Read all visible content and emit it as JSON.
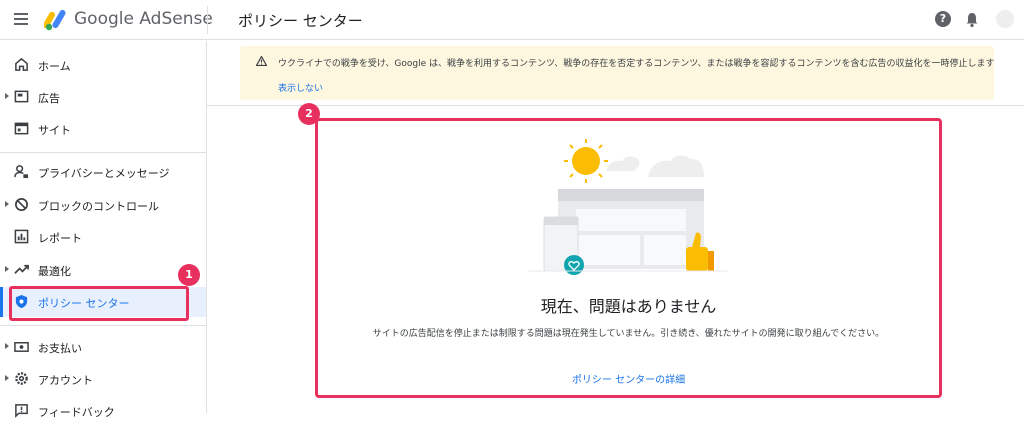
{
  "header": {
    "brand": "Google AdSense",
    "page_title": "ポリシー センター",
    "help_glyph": "?"
  },
  "sidebar": {
    "items": [
      {
        "label": "ホーム",
        "icon": "home-icon"
      },
      {
        "label": "広告",
        "icon": "ads-icon"
      },
      {
        "label": "サイト",
        "icon": "sites-icon"
      },
      {
        "label": "プライバシーとメッセージ",
        "icon": "privacy-icon"
      },
      {
        "label": "ブロックのコントロール",
        "icon": "block-icon"
      },
      {
        "label": "レポート",
        "icon": "report-icon"
      },
      {
        "label": "最適化",
        "icon": "trend-icon"
      },
      {
        "label": "ポリシー センター",
        "icon": "shield-icon"
      },
      {
        "label": "お支払い",
        "icon": "payments-icon"
      },
      {
        "label": "アカウント",
        "icon": "gear-icon"
      },
      {
        "label": "フィードバック",
        "icon": "feedback-icon"
      }
    ]
  },
  "markers": {
    "m1": "1",
    "m2": "2"
  },
  "banner": {
    "text": "ウクライナでの戦争を受け、Google は、戦争を利用するコンテンツ、戦争の存在を否定するコンテンツ、または戦争を容認するコンテンツを含む広告の収益化を一時停止します",
    "link": "表示しない"
  },
  "card": {
    "title": "現在、問題はありません",
    "description": "サイトの広告配信を停止または制限する問題は現在発生していません。引き続き、優れたサイトの開発に取り組んでください。",
    "link": "ポリシー センターの詳細"
  },
  "colors": {
    "accent": "#1a73e8",
    "highlight": "#e8305f",
    "banner_bg": "#fef7e0"
  }
}
